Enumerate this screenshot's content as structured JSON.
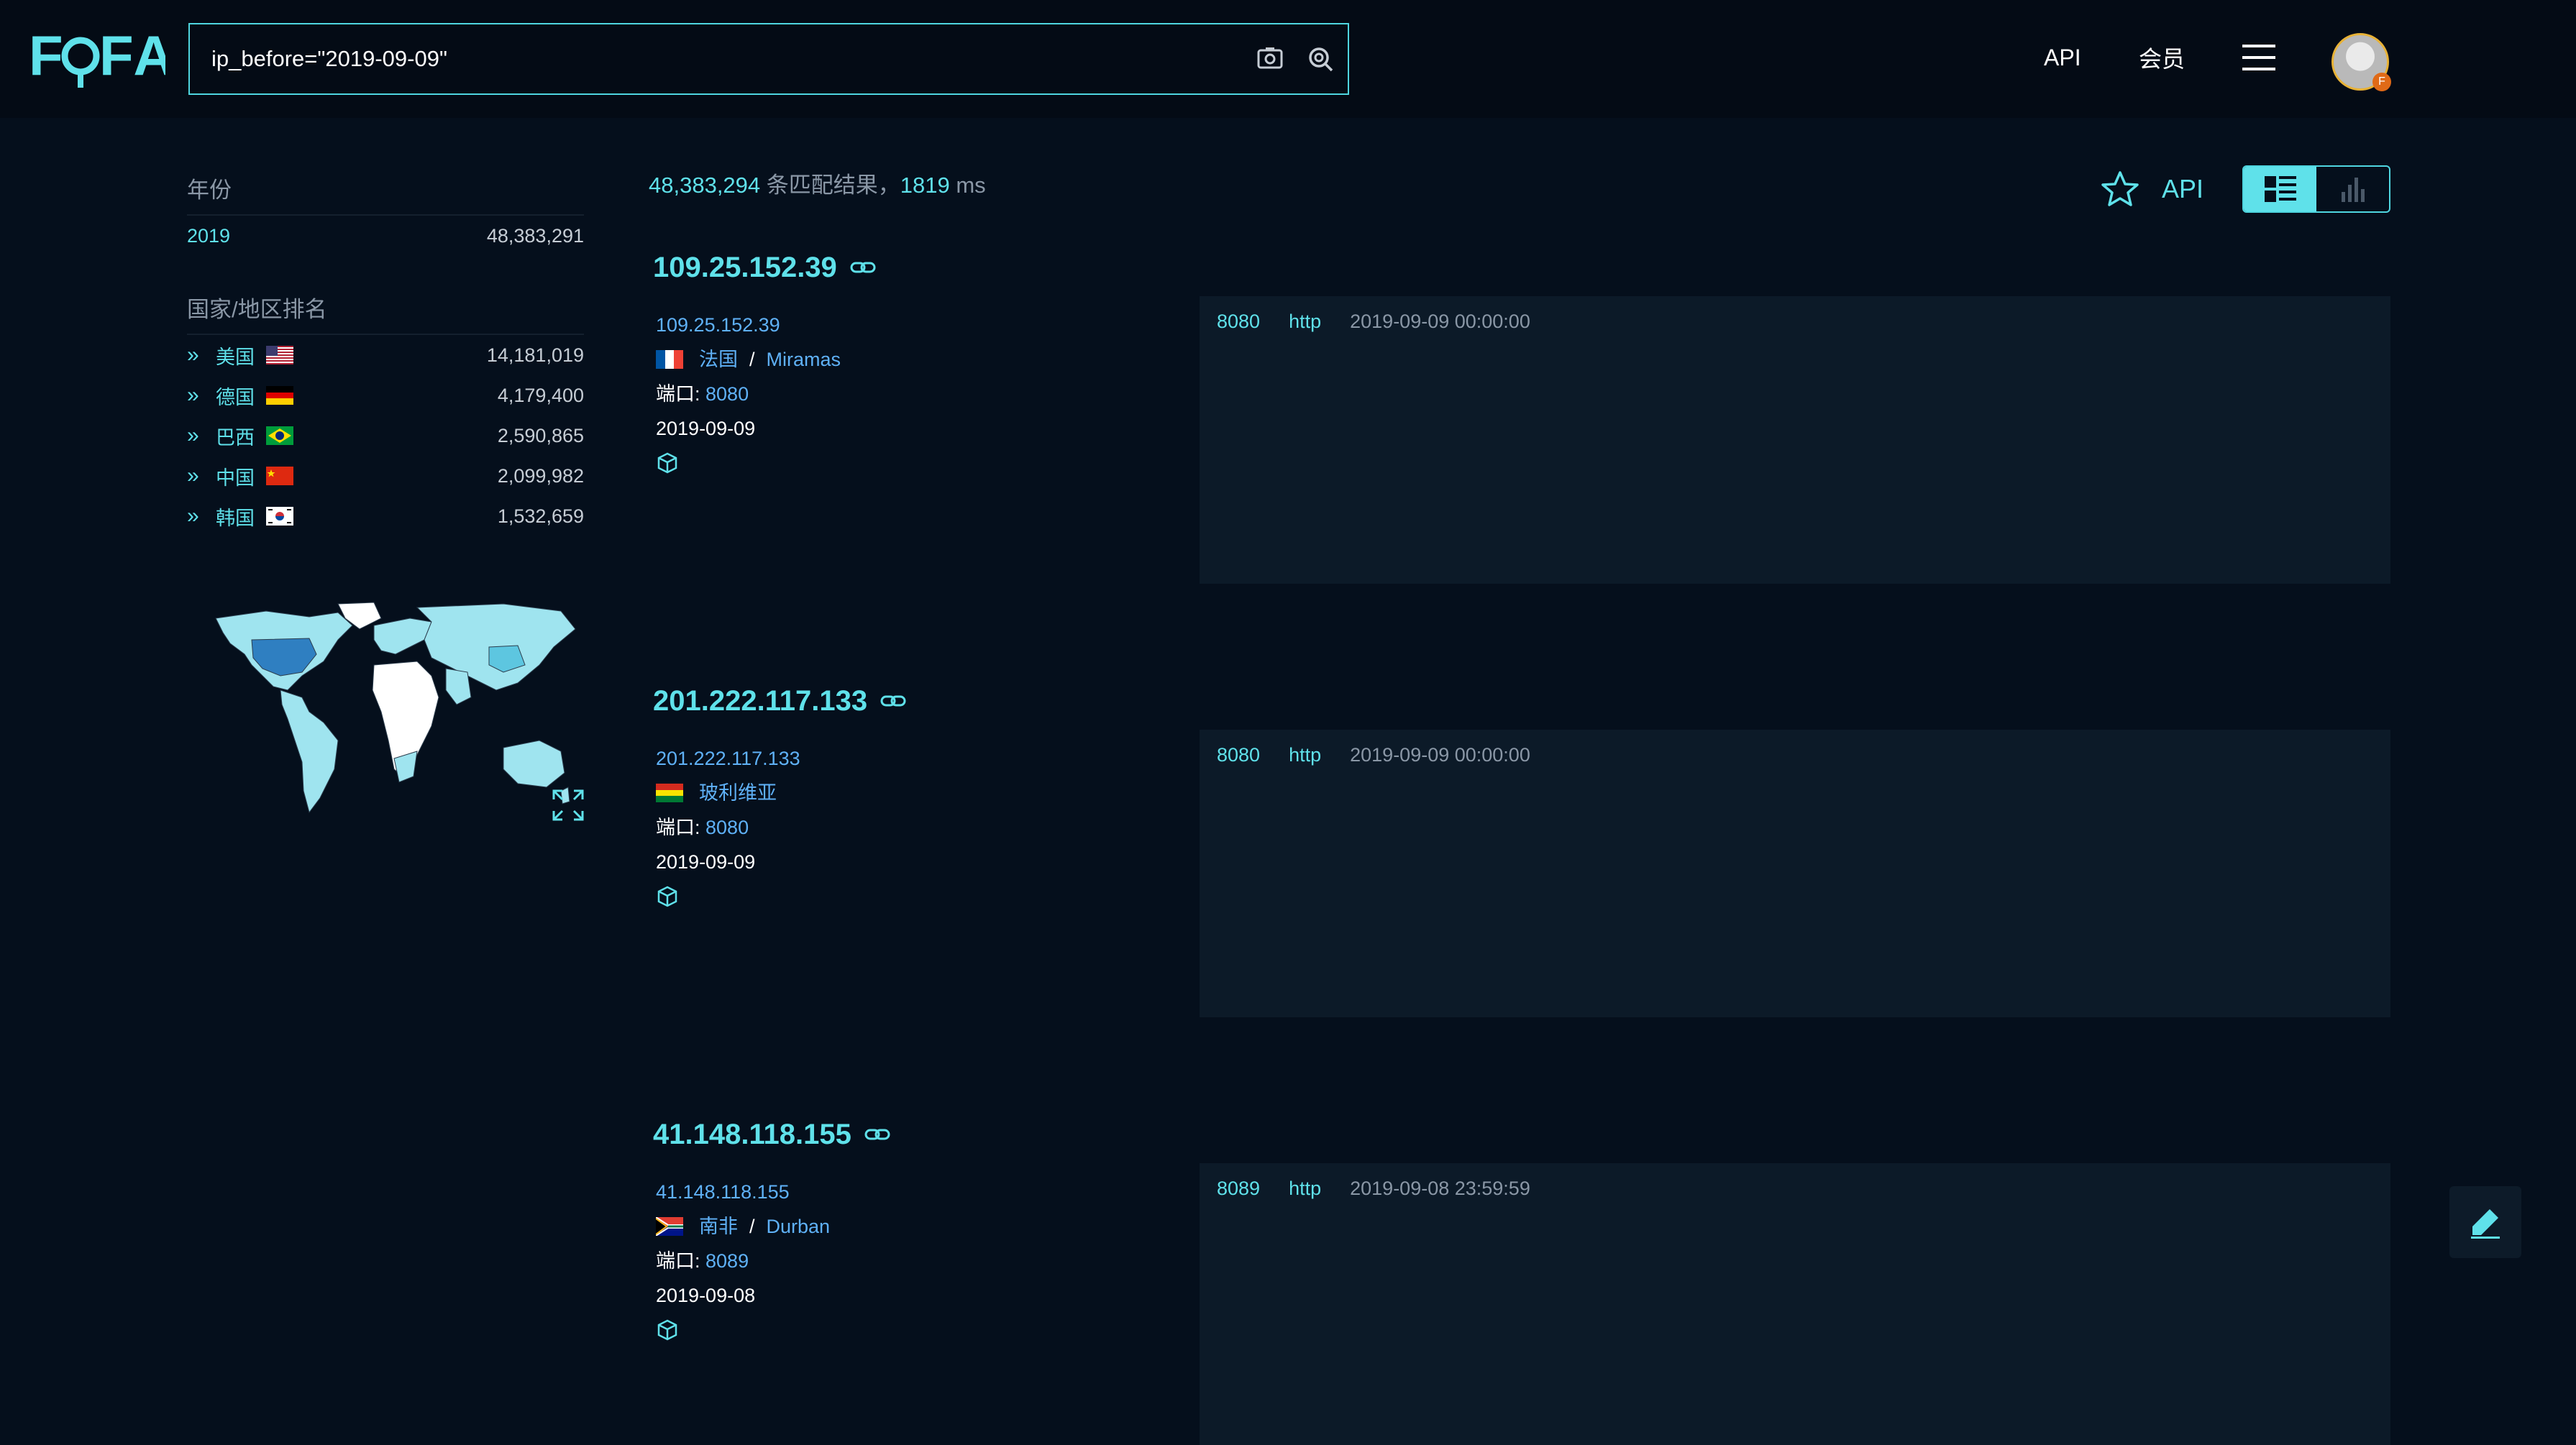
{
  "header": {
    "logo": "FOFA",
    "search_query": "ip_before=\"2019-09-09\"",
    "nav": {
      "api": "API",
      "member": "会员"
    }
  },
  "sidebar": {
    "year_title": "年份",
    "years": [
      {
        "label": "2019",
        "count": "48,383,291"
      }
    ],
    "country_title": "国家/地区排名",
    "countries": [
      {
        "name": "美国",
        "count": "14,181,019",
        "flag": "us"
      },
      {
        "name": "德国",
        "count": "4,179,400",
        "flag": "de"
      },
      {
        "name": "巴西",
        "count": "2,590,865",
        "flag": "br"
      },
      {
        "name": "中国",
        "count": "2,099,982",
        "flag": "cn"
      },
      {
        "name": "韩国",
        "count": "1,532,659",
        "flag": "kr"
      }
    ]
  },
  "summary": {
    "total": "48,383,294",
    "text": " 条匹配结果，",
    "ms": "1819",
    "ms_unit": " ms"
  },
  "toolbar": {
    "api": "API"
  },
  "results": [
    {
      "ip": "109.25.152.39",
      "ip_link": "109.25.152.39",
      "country": "法国",
      "city": "Miramas",
      "sep": "/",
      "port_label": "端口: ",
      "port": "8080",
      "date": "2019-09-09",
      "panel_port": "8080",
      "panel_proto": "http",
      "panel_time": "2019-09-09 00:00:00",
      "flag": "fr"
    },
    {
      "ip": "201.222.117.133",
      "ip_link": "201.222.117.133",
      "country": "玻利维亚",
      "city": "",
      "sep": "",
      "port_label": "端口: ",
      "port": "8080",
      "date": "2019-09-09",
      "panel_port": "8080",
      "panel_proto": "http",
      "panel_time": "2019-09-09 00:00:00",
      "flag": "bo"
    },
    {
      "ip": "41.148.118.155",
      "ip_link": "41.148.118.155",
      "country": "南非",
      "city": "Durban",
      "sep": "/",
      "port_label": "端口: ",
      "port": "8089",
      "date": "2019-09-08",
      "panel_port": "8089",
      "panel_proto": "http",
      "panel_time": "2019-09-08 23:59:59",
      "flag": "za"
    }
  ],
  "colors": {
    "accent": "#5fe1ea",
    "link": "#5fb1f7",
    "background": "#050f1c",
    "panel": "#0c1a28"
  }
}
